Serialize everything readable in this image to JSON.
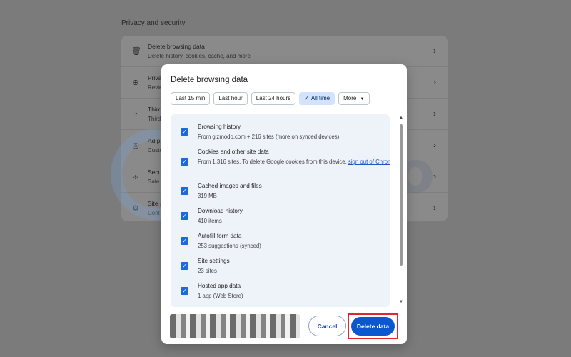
{
  "background": {
    "section_title": "Privacy and security",
    "rows": [
      {
        "title": "Delete browsing data",
        "subtitle": "Delete history, cookies, cache, and more",
        "icon": "trash-icon"
      },
      {
        "title": "Priva",
        "subtitle": "Revie",
        "icon": "privacy-guide-icon"
      },
      {
        "title": "Third",
        "subtitle": "Third",
        "icon": "cookie-icon"
      },
      {
        "title": "Ad p",
        "subtitle": "Custo",
        "icon": "ad-privacy-icon"
      },
      {
        "title": "Secu",
        "subtitle": "Safe",
        "icon": "shield-icon"
      },
      {
        "title": "Site s",
        "subtitle": "Cont",
        "icon": "tune-icon"
      }
    ]
  },
  "dialog": {
    "title": "Delete browsing data",
    "time_ranges": [
      "Last 15 min",
      "Last hour",
      "Last 24 hours",
      "All time",
      "More"
    ],
    "selected_range": "All time",
    "items": [
      {
        "title": "Browsing history",
        "detail": "From gizmodo.com + 216 sites (more on synced devices)",
        "checked": true
      },
      {
        "title": "Cookies and other site data",
        "detail": "From 1,316 sites. To delete Google cookies from this device,",
        "link": "sign out of Chrome",
        "after_link": ".",
        "checked": true
      },
      {
        "title": "Cached images and files",
        "detail": "319 MB",
        "checked": true
      },
      {
        "title": "Download history",
        "detail": "410 items",
        "checked": true
      },
      {
        "title": "Autofill form data",
        "detail": "253 suggestions (synced)",
        "checked": true
      },
      {
        "title": "Site settings",
        "detail": "23 sites",
        "checked": true
      },
      {
        "title": "Hosted app data",
        "detail": "1 app (Web Store)",
        "checked": true
      }
    ],
    "cancel_label": "Cancel",
    "delete_label": "Delete data"
  },
  "watermark": "safelyo",
  "colors": {
    "accent": "#0b57d0",
    "highlight": "#e0262f",
    "chip_selected": "#d3e3fd",
    "list_bg": "#eef2f9"
  }
}
